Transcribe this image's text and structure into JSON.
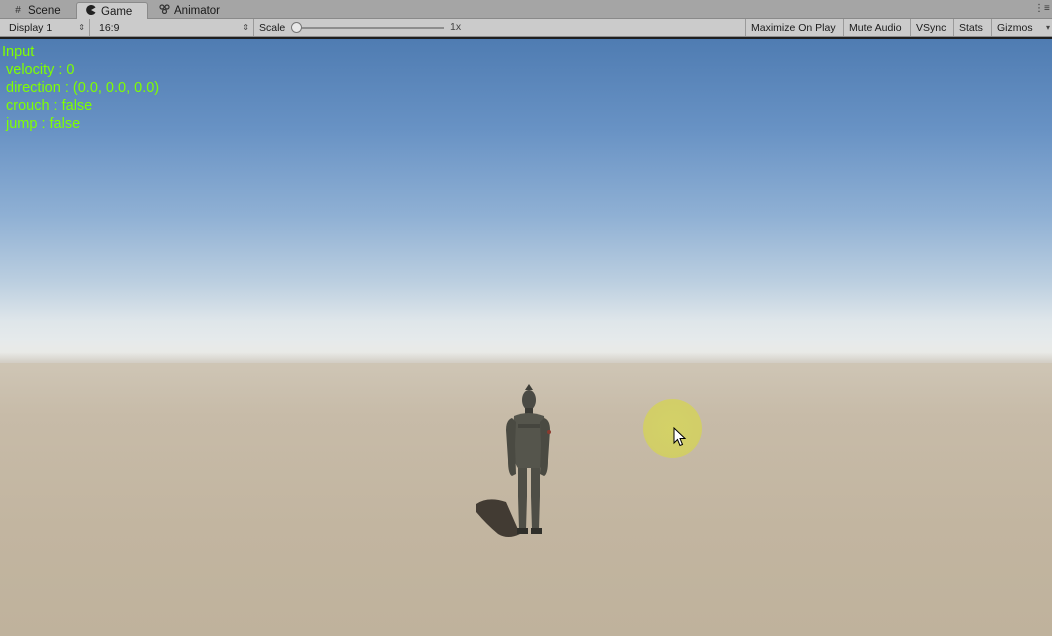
{
  "tabs": [
    {
      "label": "Scene",
      "icon": "hash-grid-icon"
    },
    {
      "label": "Game",
      "icon": "pacman-icon"
    },
    {
      "label": "Animator",
      "icon": "animator-icon"
    }
  ],
  "toolbar": {
    "display": "Display 1",
    "aspect": "16:9",
    "scale_label": "Scale",
    "scale_value": "1x",
    "maximize_on_play": "Maximize On Play",
    "mute_audio": "Mute Audio",
    "vsync": "VSync",
    "stats": "Stats",
    "gizmos": "Gizmos"
  },
  "debug": {
    "title": "Input",
    "velocity": "velocity : 0",
    "direction": "direction : (0.0, 0.0, 0.0)",
    "crouch": "crouch : false",
    "jump": "jump : false"
  },
  "colors": {
    "debug_text": "#7fff00",
    "sky_top": "#4f7cb2",
    "ground": "#c2b5a0",
    "cursor_highlight": "#d6d65c"
  }
}
